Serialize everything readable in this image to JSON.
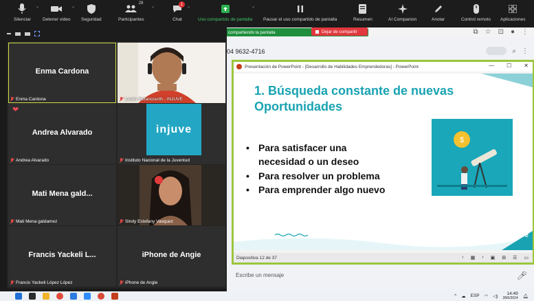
{
  "toolbar": {
    "buttons": [
      {
        "label": "Silenciar"
      },
      {
        "label": "Detener video"
      },
      {
        "label": "Seguridad"
      },
      {
        "label": "Participantes",
        "count": "28"
      },
      {
        "label": "Chat",
        "badge": "1"
      },
      {
        "label": "Uso compartido de pantalla"
      },
      {
        "label": "Pausar el uso compartido de pantalla"
      },
      {
        "label": "Resumen"
      },
      {
        "label": "AI Companion"
      },
      {
        "label": "Anotar"
      },
      {
        "label": "Control remoto"
      },
      {
        "label": "Aplicaciones"
      }
    ]
  },
  "share_bar": {
    "status": "compartiendo la pantalla",
    "stop_label": "Dejar de compartir"
  },
  "gallery": {
    "tiles": [
      {
        "display": "Enma Cardona",
        "label": "Enma Cardona"
      },
      {
        "display": "",
        "label": "Lester Betancourth - INJUVE"
      },
      {
        "display": "Andrea Alvarado",
        "label": "Andrea Alvarado"
      },
      {
        "display": "",
        "label": "Instituto Nacional de la Juventud"
      },
      {
        "display": "Mati Mena gald...",
        "label": "Mati Mena galdamez"
      },
      {
        "display": "",
        "label": "Sindy Estefany Vasquez"
      },
      {
        "display": "Francis Yackeli L...",
        "label": "Francis Yackeli López López"
      },
      {
        "display": "iPhone de Angie",
        "label": "iPhone de Angie"
      }
    ],
    "injuve_logo": "injuve"
  },
  "browser": {
    "phone": "04 9632-4716",
    "message_placeholder": "Escribe un mensaje"
  },
  "ppt": {
    "window_title": "Presentación de PowerPoint - [Desarrollo de Habilidades Emprendedoras] - PowerPoint",
    "slide_title_line1": "1. Búsqueda constante de nuevas",
    "slide_title_line2": "Oportunidades",
    "bullets": [
      "Para satisfacer una",
      "necesidad o un deseo",
      "Para resolver un problema",
      "Para emprender algo nuevo"
    ],
    "slide_counter": "Diapositiva 12 de 37",
    "footer_logo": "injuve"
  },
  "taskbar": {
    "lang": "ESP",
    "time": "14:49",
    "date": "28/6/2024"
  }
}
